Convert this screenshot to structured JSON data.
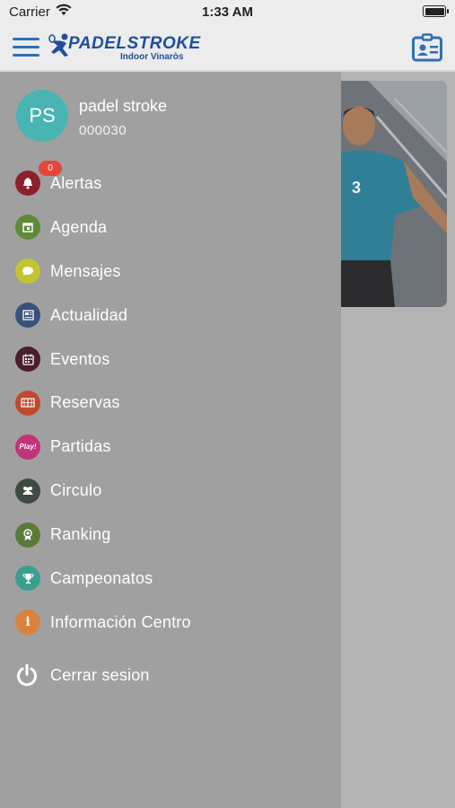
{
  "status_bar": {
    "carrier": "Carrier",
    "time": "1:33 AM"
  },
  "header": {
    "logo_main": "PADELSTROKE",
    "logo_sub": "Indoor Vinaròs",
    "accent_color": "#1d4f9c"
  },
  "user": {
    "initials": "PS",
    "name": "padel stroke",
    "id": "000030",
    "avatar_color": "#4ab4b2"
  },
  "menu": [
    {
      "label": "Alertas",
      "icon": "bell-icon",
      "color": "#8e1f2c",
      "badge": "0"
    },
    {
      "label": "Agenda",
      "icon": "calendar-icon",
      "color": "#5f8a3a"
    },
    {
      "label": "Mensajes",
      "icon": "chat-icon",
      "color": "#c3c530"
    },
    {
      "label": "Actualidad",
      "icon": "newspaper-icon",
      "color": "#3a5277"
    },
    {
      "label": "Eventos",
      "icon": "calendar-grid-icon",
      "color": "#4a1e2d"
    },
    {
      "label": "Reservas",
      "icon": "court-icon",
      "color": "#c0492f"
    },
    {
      "label": "Partidas",
      "icon": "play-icon",
      "color": "#c2337a",
      "icon_text": "Play!"
    },
    {
      "label": "Circulo",
      "icon": "group-icon",
      "color": "#3f4a43"
    },
    {
      "label": "Ranking",
      "icon": "medal-icon",
      "color": "#5a7a3a"
    },
    {
      "label": "Campeonatos",
      "icon": "trophy-icon",
      "color": "#3aa08e"
    },
    {
      "label": "Información Centro",
      "icon": "info-icon",
      "color": "#d9823d"
    }
  ],
  "logout": {
    "label": "Cerrar sesion",
    "icon": "power-icon"
  }
}
